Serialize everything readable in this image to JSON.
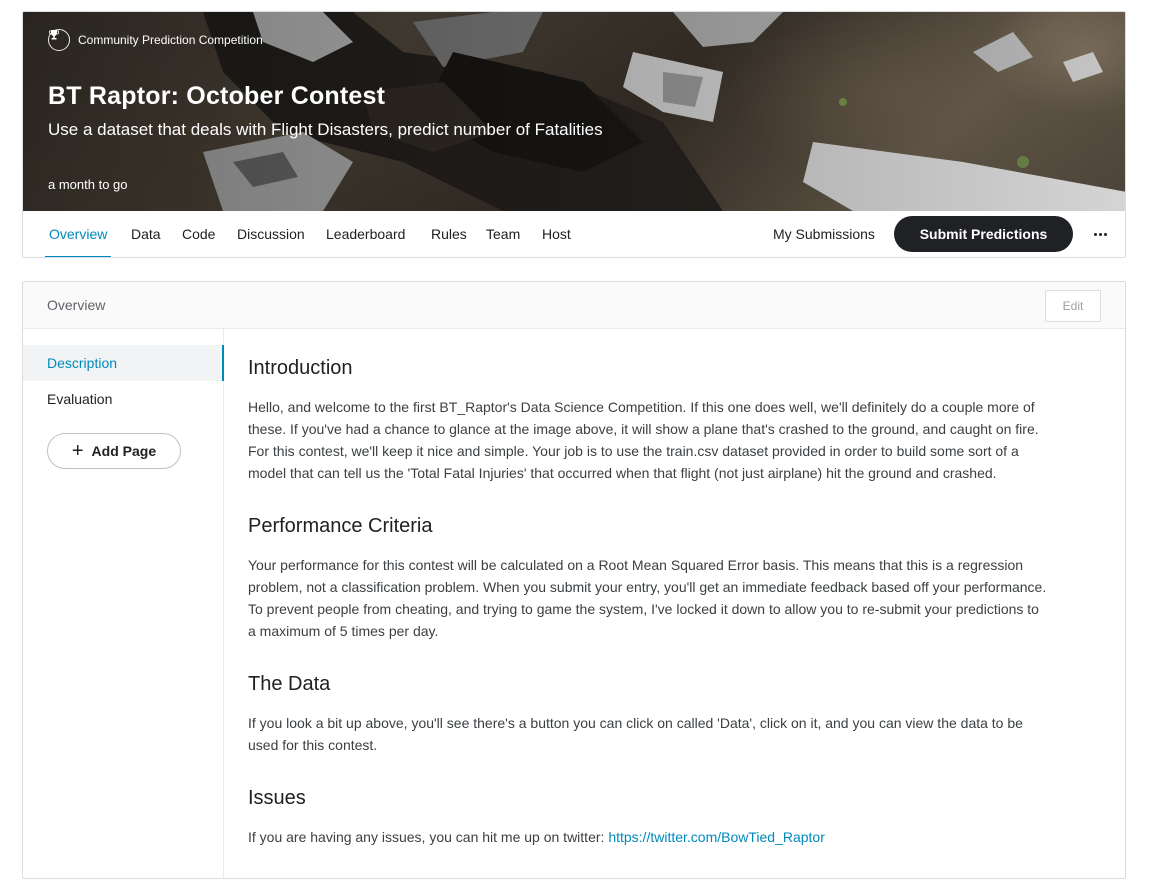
{
  "header": {
    "competition_type": "Community Prediction Competition",
    "title": "BT Raptor: October Contest",
    "subtitle": "Use a dataset that deals with Flight Disasters, predict number of Fatalities",
    "deadline": "a month to go"
  },
  "tabs": [
    {
      "label": "Overview",
      "active": true
    },
    {
      "label": "Data"
    },
    {
      "label": "Code"
    },
    {
      "label": "Discussion"
    },
    {
      "label": "Leaderboard"
    },
    {
      "label": "Rules"
    },
    {
      "label": "Team"
    },
    {
      "label": "Host"
    }
  ],
  "actions": {
    "my_submissions": "My Submissions",
    "submit_predictions": "Submit Predictions"
  },
  "overview": {
    "title": "Overview",
    "edit_label": "Edit",
    "sidebar": [
      {
        "label": "Description",
        "active": true
      },
      {
        "label": "Evaluation"
      }
    ],
    "add_page_label": "Add Page",
    "sections": [
      {
        "heading": "Introduction",
        "lines": [
          "Hello, and welcome to the first BT_Raptor's Data Science Competition. If this one does well, we'll definitely do a couple more of",
          "these. If you've had a chance to glance at the image above, it will show a plane that's crashed to the ground, and caught on fire.",
          "For this contest, we'll keep it nice and simple. Your job is to use the train.csv dataset provided in order to build some sort of a",
          "model that can tell us the 'Total Fatal Injuries' that occurred when that flight (not just airplane) hit the ground and crashed."
        ]
      },
      {
        "heading": "Performance Criteria",
        "lines": [
          "Your performance for this contest will be calculated on a Root Mean Squared Error basis. This means that this is a regression",
          "problem, not a classification problem. When you submit your entry, you'll get an immediate feedback based off your performance.",
          "To prevent people from cheating, and trying to game the system, I've locked it down to allow you to re-submit your predictions to",
          "a maximum of 5 times per day."
        ]
      },
      {
        "heading": "The Data",
        "lines": [
          "If you look a bit up above, you'll see there's a button you can click on called 'Data', click on it, and you can view the data to be",
          "used for this contest."
        ]
      },
      {
        "heading": "Issues",
        "text": "If you are having any issues, you can hit me up on twitter: ",
        "link": "https://twitter.com/BowTied_Raptor"
      }
    ]
  },
  "colors": {
    "accent": "#008abc",
    "submit_bg": "#202124"
  },
  "icons": {
    "competition_type": "trophy-icon",
    "more": "more-horizontal-icon",
    "add_page": "plus-icon"
  }
}
